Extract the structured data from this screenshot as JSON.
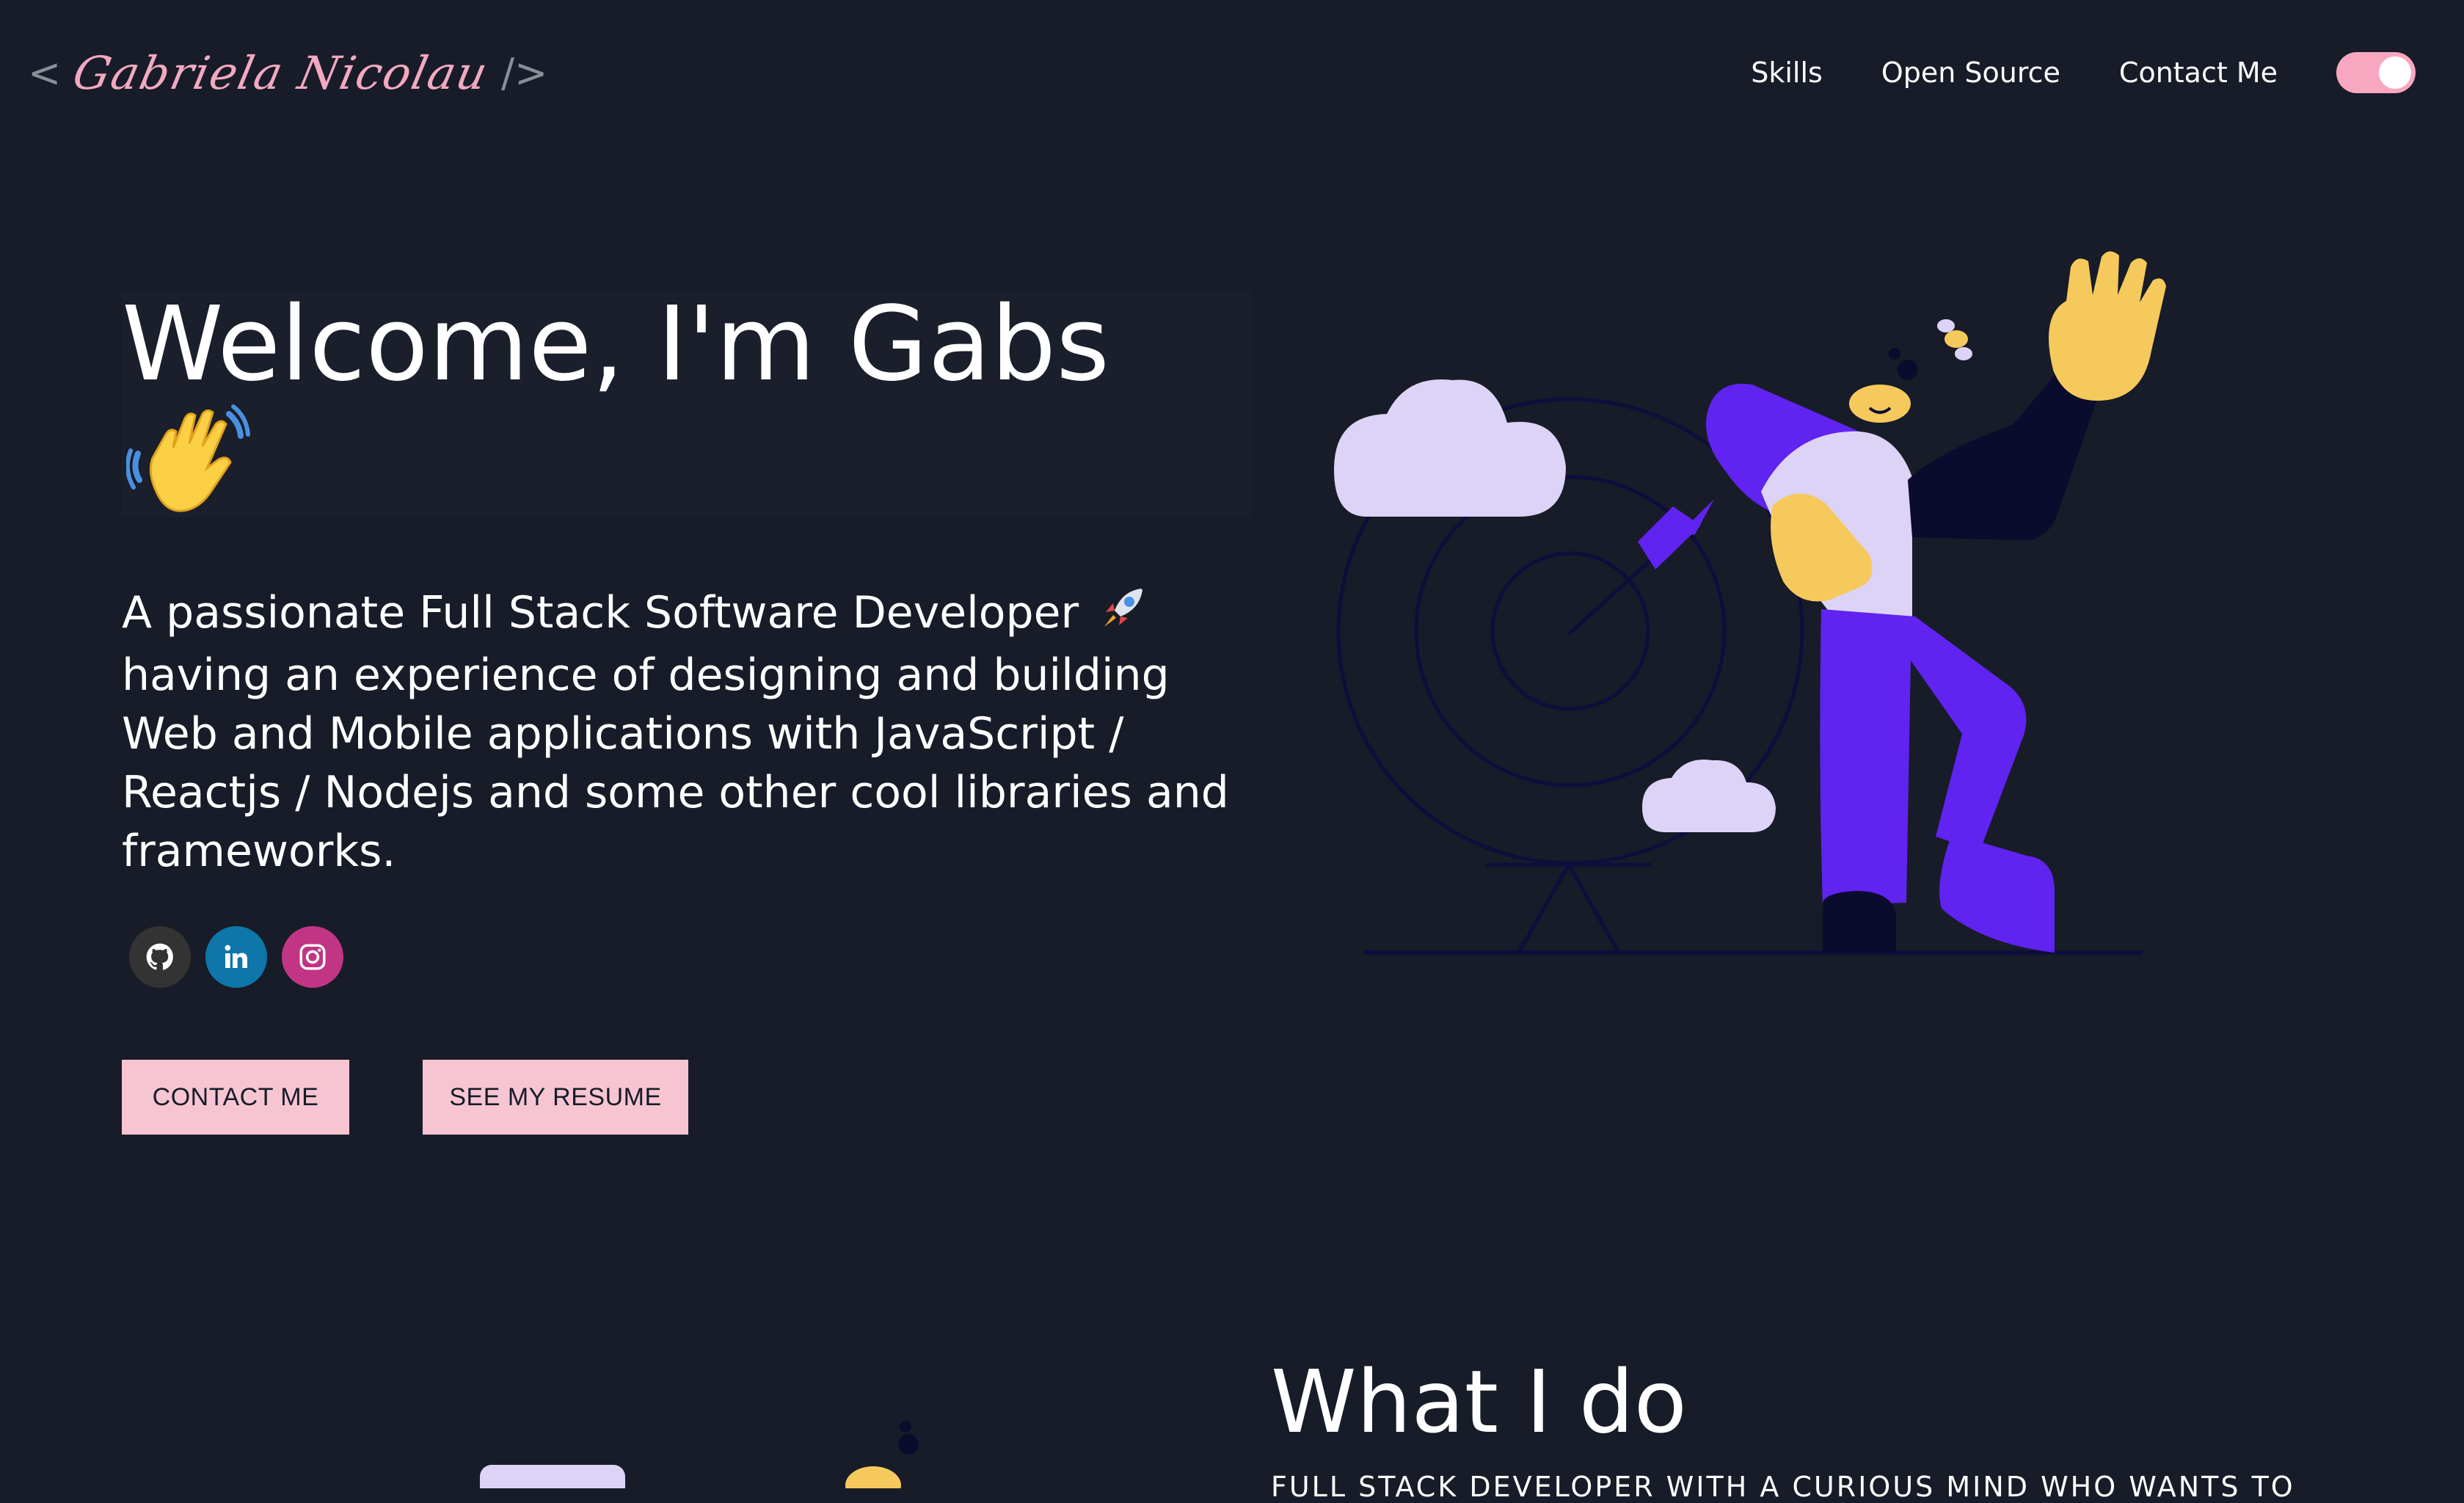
{
  "header": {
    "logo": {
      "open": "<",
      "name": "Gabriela Nicolau",
      "close": "/>"
    },
    "nav": [
      {
        "label": "Skills"
      },
      {
        "label": "Open Source"
      },
      {
        "label": "Contact Me"
      }
    ],
    "theme_toggle": {
      "state": "on",
      "color": "#f7a8c0"
    }
  },
  "hero": {
    "title": "Welcome, I'm Gabs",
    "title_emoji": "waving-hand-icon",
    "subtitle": "A passionate Full Stack Software Developer",
    "subtitle_rest": "having an experience of designing and building Web and Mobile applications with JavaScript / Reactjs / Nodejs and some other cool libraries and frameworks.",
    "subtitle_emoji": "rocket-icon",
    "socials": [
      {
        "name": "github",
        "icon": "github-icon",
        "color": "#333333"
      },
      {
        "name": "linkedin",
        "icon": "linkedin-icon",
        "color": "#0e76a8"
      },
      {
        "name": "instagram",
        "icon": "instagram-icon",
        "color": "#c13584"
      }
    ],
    "buttons": {
      "contact": "CONTACT ME",
      "resume": "SEE MY RESUME"
    }
  },
  "what_i_do": {
    "title": "What I do",
    "subtitle": "FULL STACK DEVELOPER WITH A CURIOUS MIND WHO WANTS TO"
  },
  "colors": {
    "background": "#171c28",
    "accent_pink": "#f7c5d2",
    "illustration_purple": "#6023f0",
    "illustration_lilac": "#dcd3f7",
    "illustration_yellow": "#f5c95c"
  }
}
